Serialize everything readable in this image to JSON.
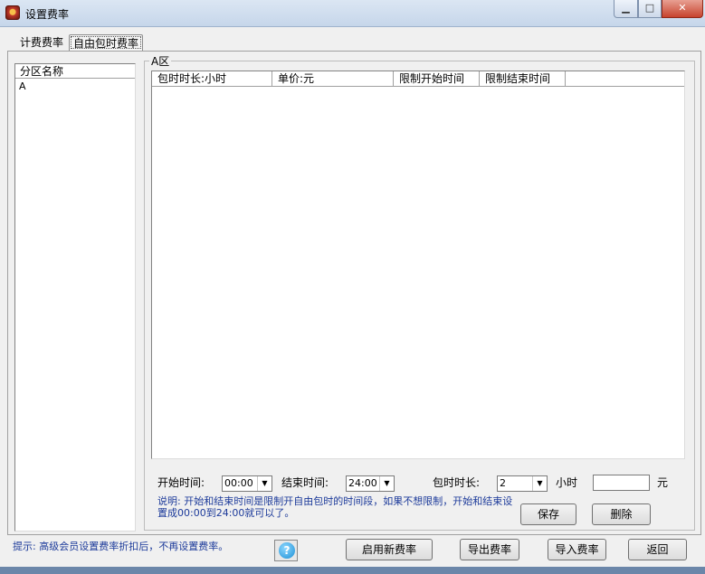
{
  "window": {
    "title": "设置费率",
    "min_label": "▁",
    "max_label": "□",
    "close_label": "✕"
  },
  "tabs": [
    {
      "label": "计费费率",
      "active": false
    },
    {
      "label": "自由包时费率",
      "active": true
    }
  ],
  "zone_list": {
    "header": "分区名称",
    "items": [
      "A"
    ]
  },
  "group": {
    "title": "A区"
  },
  "grid": {
    "columns": [
      "包时时长:小时",
      "单价:元",
      "限制开始时间",
      "限制结束时间"
    ],
    "rows": []
  },
  "form": {
    "start_label": "开始时间:",
    "start_value": "00:00",
    "end_label": "结束时间:",
    "end_value": "24:00",
    "duration_label": "包时时长:",
    "duration_value": "2",
    "hours_unit": "小时",
    "price_value": "",
    "yuan_unit": "元",
    "note": "说明: 开始和结束时间是限制开自由包时的时间段，如果不想限制，开始和结束设置成00:00到24:00就可以了。"
  },
  "buttons": {
    "save": "保存",
    "delete": "删除",
    "enable": "启用新费率",
    "export": "导出费率",
    "import": "导入费率",
    "back": "返回",
    "help": "?"
  },
  "tip": "提示: 高级会员设置费率折扣后，不再设置费率。",
  "colors": {
    "note_text": "#1c3a9a",
    "accent": "#1a8fd6"
  }
}
